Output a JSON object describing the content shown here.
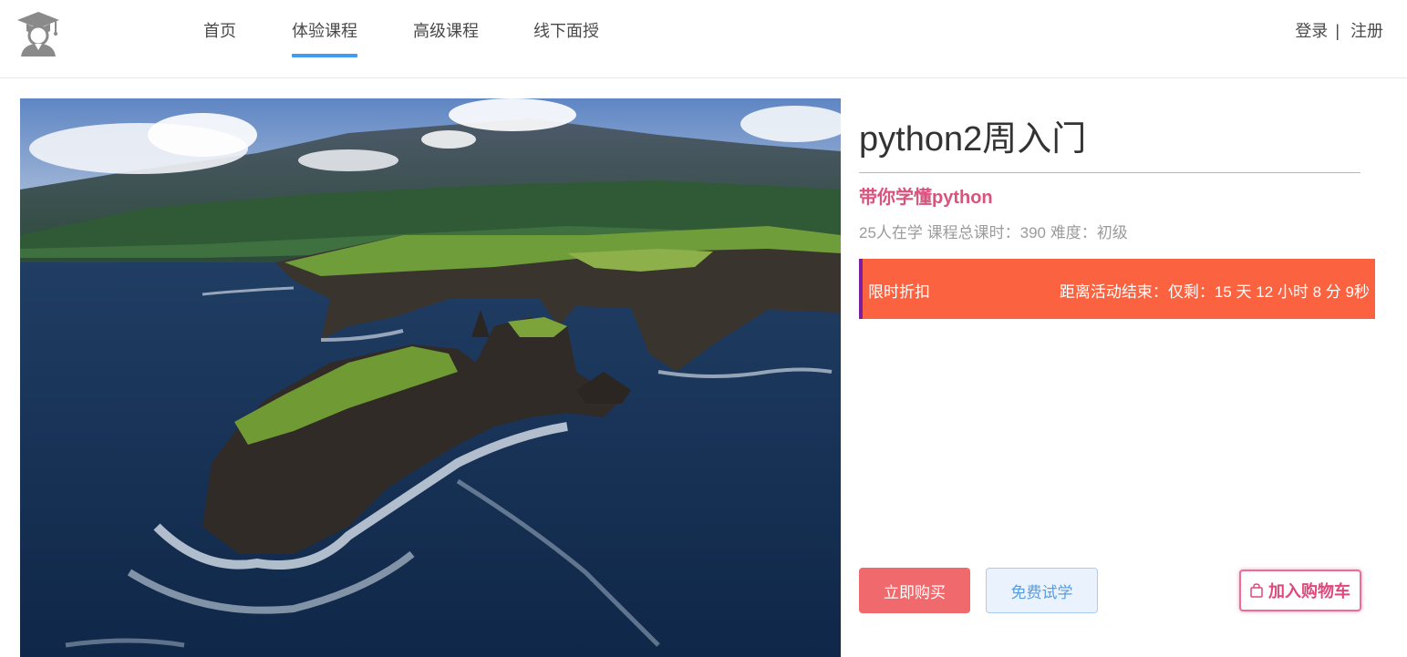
{
  "header": {
    "logo_icon": "graduate-cap-icon",
    "nav": [
      {
        "label": "首页",
        "active": false
      },
      {
        "label": "体验课程",
        "active": true
      },
      {
        "label": "高级课程",
        "active": false
      },
      {
        "label": "线下面授",
        "active": false
      }
    ],
    "login_label": "登录",
    "separator": "|",
    "register_label": "注册",
    "accent_color": "#3f9cf0"
  },
  "course": {
    "title": "python2周入门",
    "subtitle": "带你学懂python",
    "meta": "25人在学 课程总课时：390 难度：初级",
    "promo": {
      "label": "限时折扣",
      "countdown": "距离活动结束：仅剩：15 天 12 小时 8 分 9秒",
      "bg_color": "#fa6240"
    },
    "buttons": {
      "buy": "立即购买",
      "try": "免费试学",
      "cart": "加入购物车",
      "cart_icon": "shopping-bag-icon"
    }
  }
}
